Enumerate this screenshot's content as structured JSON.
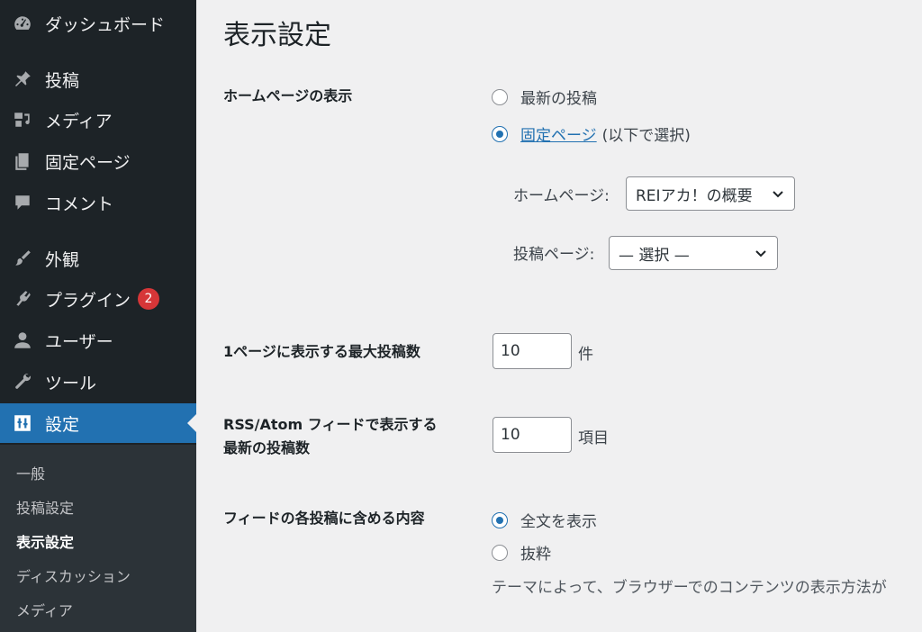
{
  "sidebar": {
    "items": [
      {
        "label": "ダッシュボード",
        "icon": "dashboard-icon"
      },
      {
        "label": "投稿",
        "icon": "pin-icon"
      },
      {
        "label": "メディア",
        "icon": "media-icon"
      },
      {
        "label": "固定ページ",
        "icon": "pages-icon"
      },
      {
        "label": "コメント",
        "icon": "comment-icon"
      },
      {
        "label": "外観",
        "icon": "brush-icon"
      },
      {
        "label": "プラグイン",
        "icon": "plugin-icon",
        "badge": "2"
      },
      {
        "label": "ユーザー",
        "icon": "user-icon"
      },
      {
        "label": "ツール",
        "icon": "wrench-icon"
      },
      {
        "label": "設定",
        "icon": "settings-icon",
        "active": true
      }
    ],
    "submenu": [
      {
        "label": "一般"
      },
      {
        "label": "投稿設定"
      },
      {
        "label": "表示設定",
        "current": true
      },
      {
        "label": "ディスカッション"
      },
      {
        "label": "メディア"
      }
    ]
  },
  "main": {
    "title": "表示設定",
    "homepage_display": {
      "label": "ホームページの表示",
      "options": [
        {
          "label": "最新の投稿",
          "checked": false
        },
        {
          "label": "固定ページ",
          "suffix": "(以下で選択)",
          "checked": true
        }
      ],
      "homepage_label": "ホームページ:",
      "homepage_value": "REIアカ！の概要",
      "posts_page_label": "投稿ページ:",
      "posts_page_value": "— 選択 —"
    },
    "posts_per_page": {
      "label": "1ページに表示する最大投稿数",
      "value": "10",
      "unit": "件"
    },
    "feed_count": {
      "label_line1": "RSS/Atom フィードで表示する",
      "label_line2": "最新の投稿数",
      "value": "10",
      "unit": "項目"
    },
    "feed_content": {
      "label": "フィードの各投稿に含める内容",
      "options": [
        {
          "label": "全文を表示",
          "checked": true
        },
        {
          "label": "抜粋",
          "checked": false
        }
      ],
      "description": "テーマによって、ブラウザーでのコンテンツの表示方法が"
    }
  },
  "colors": {
    "sidebar_bg": "#1d2327",
    "active_bg": "#2271b1",
    "badge": "#d63638",
    "page_bg": "#f0f0f1"
  }
}
